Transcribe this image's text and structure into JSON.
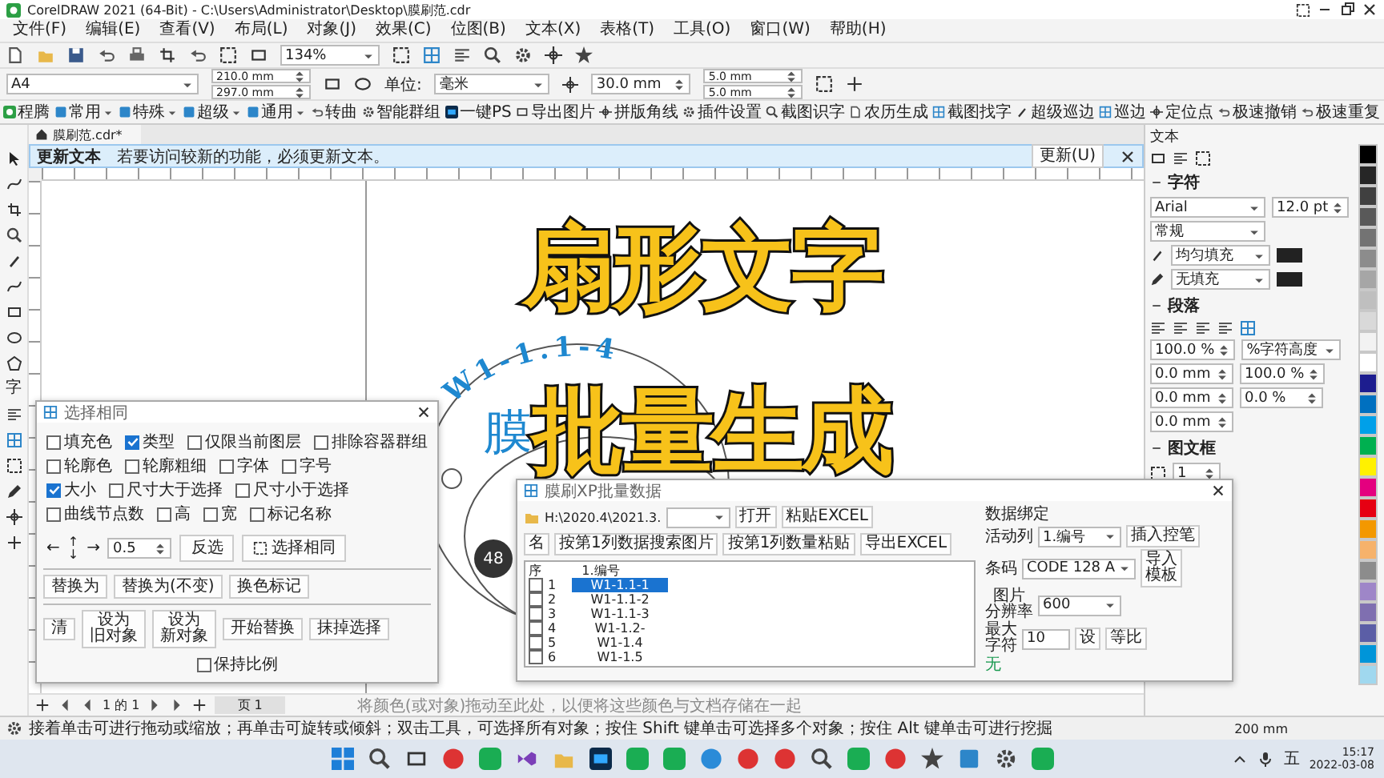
{
  "window": {
    "title": "CorelDRAW 2021 (64-Bit) - C:\\Users\\Administrator\\Desktop\\膜刷范.cdr"
  },
  "menu": [
    {
      "label": "文件(F)"
    },
    {
      "label": "编辑(E)"
    },
    {
      "label": "查看(V)"
    },
    {
      "label": "布局(L)"
    },
    {
      "label": "对象(J)"
    },
    {
      "label": "效果(C)"
    },
    {
      "label": "位图(B)"
    },
    {
      "label": "文本(X)"
    },
    {
      "label": "表格(T)"
    },
    {
      "label": "工具(O)"
    },
    {
      "label": "窗口(W)"
    },
    {
      "label": "帮助(H)"
    }
  ],
  "toolbar": {
    "zoom": "134%"
  },
  "property_bar": {
    "page_size": "A4",
    "width": "210.0 mm",
    "height": "297.0 mm",
    "units_label": "单位:",
    "units": "毫米",
    "nudge": "30.0 mm",
    "dup_x": "5.0 mm",
    "dup_y": "5.0 mm"
  },
  "plugin_bar": [
    {
      "label": "程腾",
      "menu": false
    },
    {
      "label": "常用",
      "menu": true
    },
    {
      "label": "特殊",
      "menu": true
    },
    {
      "label": "超级",
      "menu": true
    },
    {
      "label": "通用",
      "menu": true
    },
    {
      "label": "转曲",
      "menu": false
    },
    {
      "label": "智能群组",
      "menu": false
    },
    {
      "label": "一键PS",
      "menu": false
    },
    {
      "label": "导出图片",
      "menu": false
    },
    {
      "label": "拼版角线",
      "menu": false
    },
    {
      "label": "插件设置",
      "menu": false
    },
    {
      "label": "截图识字",
      "menu": false
    },
    {
      "label": "农历生成",
      "menu": false
    },
    {
      "label": "截图找字",
      "menu": false
    },
    {
      "label": "超级巡边",
      "menu": false
    },
    {
      "label": "巡边",
      "menu": false
    },
    {
      "label": "定位点",
      "menu": false
    },
    {
      "label": "极速撤销",
      "menu": false
    },
    {
      "label": "极速重复",
      "menu": false
    }
  ],
  "document_tab": {
    "title": "膜刷范.cdr*"
  },
  "info_bar": {
    "title": "更新文本",
    "message": "若要访问较新的功能，必须更新文本。",
    "button": "更新(U)"
  },
  "toolbox": {
    "text_tool": "字"
  },
  "canvas": {
    "headline": "扇形文字",
    "subline": "批量生成",
    "arc_text": "W1-1.1-4",
    "glyph": "膜"
  },
  "page_nav": {
    "pages": "1 的 1",
    "tab": "页 1",
    "hint": "将颜色(或对象)拖动至此处，以便将这些颜色与文档存储在一起"
  },
  "docker": {
    "title": "文本",
    "character": {
      "heading": "字符",
      "font": "Arial",
      "size": "12.0 pt",
      "style": "常规",
      "fill": "均匀填充",
      "outline": "无填充"
    },
    "paragraph": {
      "heading": "段落",
      "line_spacing": "100.0 %",
      "spacing_unit": "%字符高度",
      "indent_left": "0.0 mm",
      "char_spacing": "100.0 %",
      "indent_first": "0.0 mm",
      "word_spacing": "0.0 %",
      "indent_right": "0.0 mm"
    },
    "frame": {
      "heading": "图文框",
      "columns": "1"
    }
  },
  "palette": [
    {
      "color": "#000000"
    },
    {
      "color": "#262626"
    },
    {
      "color": "#404040"
    },
    {
      "color": "#595959"
    },
    {
      "color": "#737373"
    },
    {
      "color": "#8c8c8c"
    },
    {
      "color": "#a6a6a6"
    },
    {
      "color": "#bfbfbf"
    },
    {
      "color": "#d9d9d9"
    },
    {
      "color": "#f2f2f2"
    },
    {
      "color": "#ffffff"
    },
    {
      "color": "#1d1d8f"
    },
    {
      "color": "#0070c0"
    },
    {
      "color": "#00a0e9"
    },
    {
      "color": "#00b050"
    },
    {
      "color": "#fff100"
    },
    {
      "color": "#e4007f"
    },
    {
      "color": "#e60012"
    },
    {
      "color": "#f39800"
    },
    {
      "color": "#f6b26b"
    },
    {
      "color": "#8c8c8c"
    },
    {
      "color": "#9e86c8"
    },
    {
      "color": "#7f6fb0"
    },
    {
      "color": "#5b5ea6"
    },
    {
      "color": "#0095d9"
    },
    {
      "color": "#a0d8ef"
    }
  ],
  "select_dialog": {
    "title": "选择相同",
    "option_rows": [
      [
        {
          "label": "填充色",
          "checked": false
        },
        {
          "label": "类型",
          "checked": true
        },
        {
          "label": "仅限当前图层",
          "checked": false
        },
        {
          "label": "排除容器群组",
          "checked": false
        }
      ],
      [
        {
          "label": "轮廓色",
          "checked": false
        },
        {
          "label": "轮廓粗细",
          "checked": false
        },
        {
          "label": "字体",
          "checked": false
        },
        {
          "label": "字号",
          "checked": false
        }
      ],
      [
        {
          "label": "大小",
          "checked": true
        },
        {
          "label": "尺寸大于选择",
          "checked": false
        },
        {
          "label": "尺寸小于选择",
          "checked": false
        }
      ],
      [
        {
          "label": "曲线节点数",
          "checked": false
        },
        {
          "label": "高",
          "checked": false
        },
        {
          "label": "宽",
          "checked": false
        },
        {
          "label": "标记名称",
          "checked": false
        }
      ]
    ],
    "arrows": {
      "left": "←",
      "up": "↑",
      "down": "↓",
      "right": "→"
    },
    "step": "0.5",
    "invert_button": "反选",
    "select_button": "选择相同",
    "replace_buttons": [
      "替换为",
      "替换为(不变)",
      "换色标记"
    ],
    "action_buttons": [
      {
        "lines": [
          "清"
        ]
      },
      {
        "lines": [
          "设为",
          "旧对象"
        ]
      },
      {
        "lines": [
          "设为",
          "新对象"
        ]
      },
      {
        "lines": [
          "开始替换"
        ]
      },
      {
        "lines": [
          "抹掉选择"
        ]
      }
    ],
    "keep_ratio": {
      "label": "保持比例",
      "checked": false
    }
  },
  "batch_dialog": {
    "title": "膜刷XP批量数据",
    "path": "H:\\2020.4\\2021.3.",
    "open_button": "打开",
    "paste_button": "粘贴EXCEL",
    "buttons": [
      "名",
      "按第1列数据搜索图片",
      "按第1列数量粘贴",
      "导出EXCEL"
    ],
    "columns": [
      "序",
      "1.编号"
    ],
    "rows": [
      {
        "index": "1",
        "value": "W1-1.1-1",
        "checked": false,
        "selected": true
      },
      {
        "index": "2",
        "value": "W1-1.1-2",
        "checked": false,
        "selected": false
      },
      {
        "index": "3",
        "value": "W1-1.1-3",
        "checked": false,
        "selected": false
      },
      {
        "index": "4",
        "value": "W1-1.2-",
        "checked": false,
        "selected": false
      },
      {
        "index": "5",
        "value": "W1-1.4",
        "checked": false,
        "selected": false
      },
      {
        "index": "6",
        "value": "W1-1.5",
        "checked": false,
        "selected": false
      }
    ],
    "binding": {
      "heading": "数据绑定",
      "active_label": "活动列",
      "active": "1.编号",
      "insert_button": "插入控笔",
      "barcode_label": "条码",
      "barcode": "CODE 128 A",
      "import_button": [
        "导入",
        "模板"
      ],
      "resolution_label": [
        "图片",
        "分辨率"
      ],
      "resolution": "600",
      "max_label": [
        "最大",
        "字符"
      ],
      "max": "10",
      "set_button": "设",
      "ratio_button": "等比",
      "status": "无"
    }
  },
  "overlay": {
    "badge": "48"
  },
  "status_bar": {
    "message": "接着单击可进行拖动或缩放；再单击可旋转或倾斜；双击工具，可选择所有对象；按住 Shift 键单击可选择多个对象；按住 Alt 键单击可进行挖掘",
    "coords": "200 mm"
  },
  "taskbar": {
    "ime": "五",
    "time": "15:17",
    "date": "2022-03-08"
  }
}
